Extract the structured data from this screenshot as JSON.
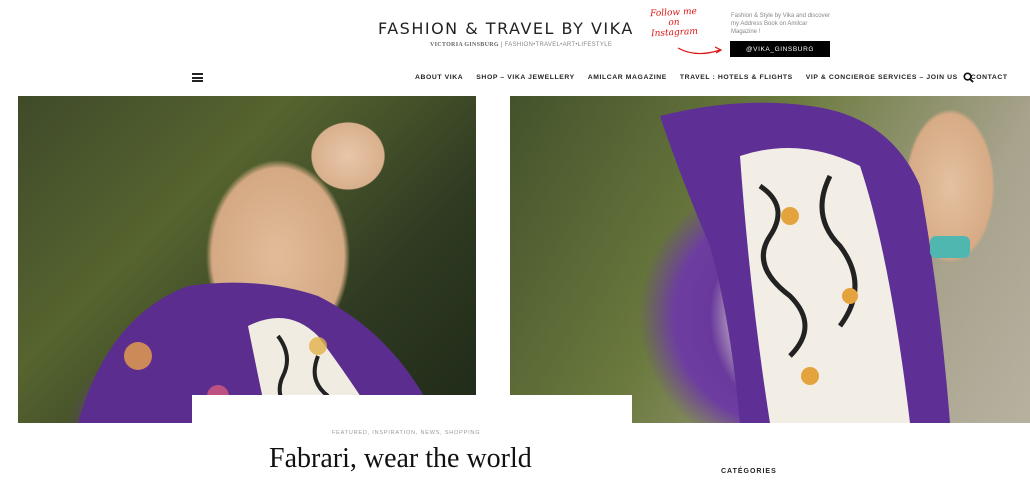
{
  "header": {
    "site_title": "FASHION & TRAVEL BY VIKA",
    "tagline_name": "VICTORIA GINSBURG",
    "tagline_rest": " | FASHION•TRAVEL•ART•LIFESTYLE",
    "follow_text": "Follow me on Instagram",
    "blurb": "Fashion & Style by Vika and discover my Address Book on Amilcar Magazine !",
    "instagram_button": "@VIKA_GINSBURG"
  },
  "nav": {
    "items": [
      {
        "label": "ABOUT VIKA"
      },
      {
        "label": "SHOP – VIKA JEWELLERY"
      },
      {
        "label": "AMILCAR MAGAZINE"
      },
      {
        "label": "TRAVEL : HOTELS & FLIGHTS"
      },
      {
        "label": "VIP & CONCIERGE SERVICES – JOIN US"
      },
      {
        "label": "CONTACT"
      }
    ],
    "menu_icon": "hamburger-icon",
    "search_icon": "search-icon"
  },
  "post": {
    "categories": "FEATURED,  INSPIRATION,  NEWS,  SHOPPING",
    "title": "Fabrari, wear the world"
  },
  "sidebar": {
    "heading": "CATÉGORIES"
  },
  "colors": {
    "accent_red": "#d11111",
    "button_bg": "#000000",
    "text": "#222222"
  }
}
